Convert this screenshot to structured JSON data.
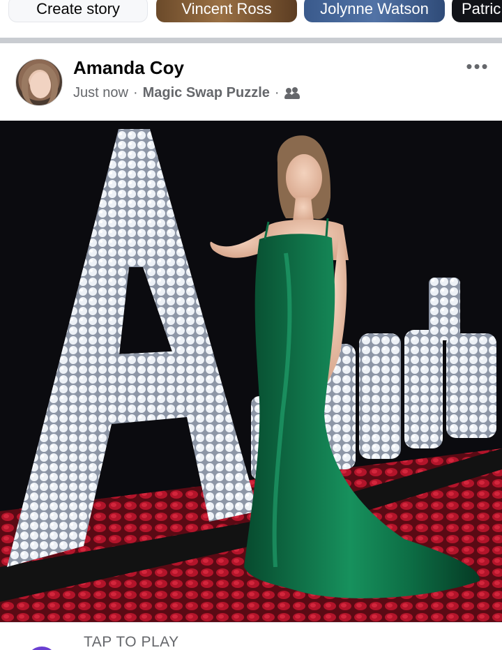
{
  "stories": [
    {
      "label": "Create story"
    },
    {
      "label": "Vincent Ross"
    },
    {
      "label": "Jolynne Watson"
    },
    {
      "label": "Patric"
    }
  ],
  "post": {
    "author": "Amanda Coy",
    "time": "Just now",
    "separator": "·",
    "group": "Magic Swap Puzzle",
    "more": "•••",
    "image_text": "Amanda"
  },
  "footer": {
    "label": "TAP TO PLAY"
  },
  "colors": {
    "dress": "#0f6b45",
    "crystal": "#e6eaf0",
    "roses": "#b3142a",
    "background": "#0b0b0f"
  }
}
